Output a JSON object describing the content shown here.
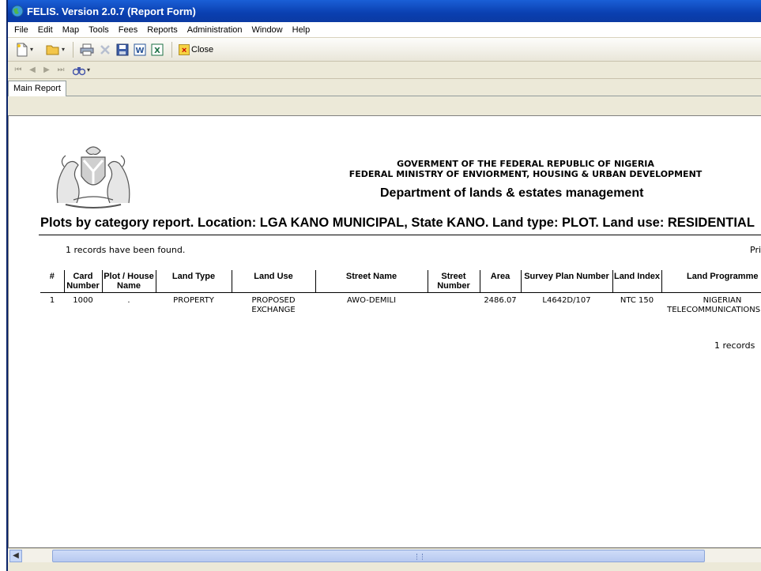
{
  "window": {
    "title": "FELIS. Version 2.0.7 (Report Form)"
  },
  "menu": [
    "File",
    "Edit",
    "Map",
    "Tools",
    "Fees",
    "Reports",
    "Administration",
    "Window",
    "Help"
  ],
  "toolbar": {
    "close_label": "Close"
  },
  "tabs": [
    {
      "label": "Main Report"
    }
  ],
  "report": {
    "header_line1": "GOVERMENT OF THE FEDERAL REPUBLIC OF NIGERIA",
    "header_line2": "FEDERAL MINISTRY OF ENVIORMENT, HOUSING & URBAN DEVELOPMENT",
    "department": "Department of lands & estates management",
    "title": "Plots by category report. Location:  LGA KANO MUNICIPAL, State KANO. Land type: PLOT. Land use: RESIDENTIAL",
    "records_found": "1  records have been found.",
    "right_cut_text": "Pri",
    "columns": [
      "#",
      "Card Number",
      "Plot / House Name",
      "Land Type",
      "Land Use",
      "Street Name",
      "Street Number",
      "Area",
      "Survey Plan Number",
      "Land Index",
      "Land Programme"
    ],
    "rows": [
      {
        "num": "1",
        "card_number": "1000",
        "plot_house_name": ".",
        "land_type": "PROPERTY",
        "land_use": "PROPOSED EXCHANGE",
        "street_name": "AWO-DEMILI",
        "street_number": "",
        "area": "2486.07",
        "survey_plan_number": "L4642D/107",
        "land_index": "NTC 150",
        "land_programme": "NIGERIAN TELECOMMUNICATIONS PLC"
      }
    ],
    "footer": "1  records"
  }
}
